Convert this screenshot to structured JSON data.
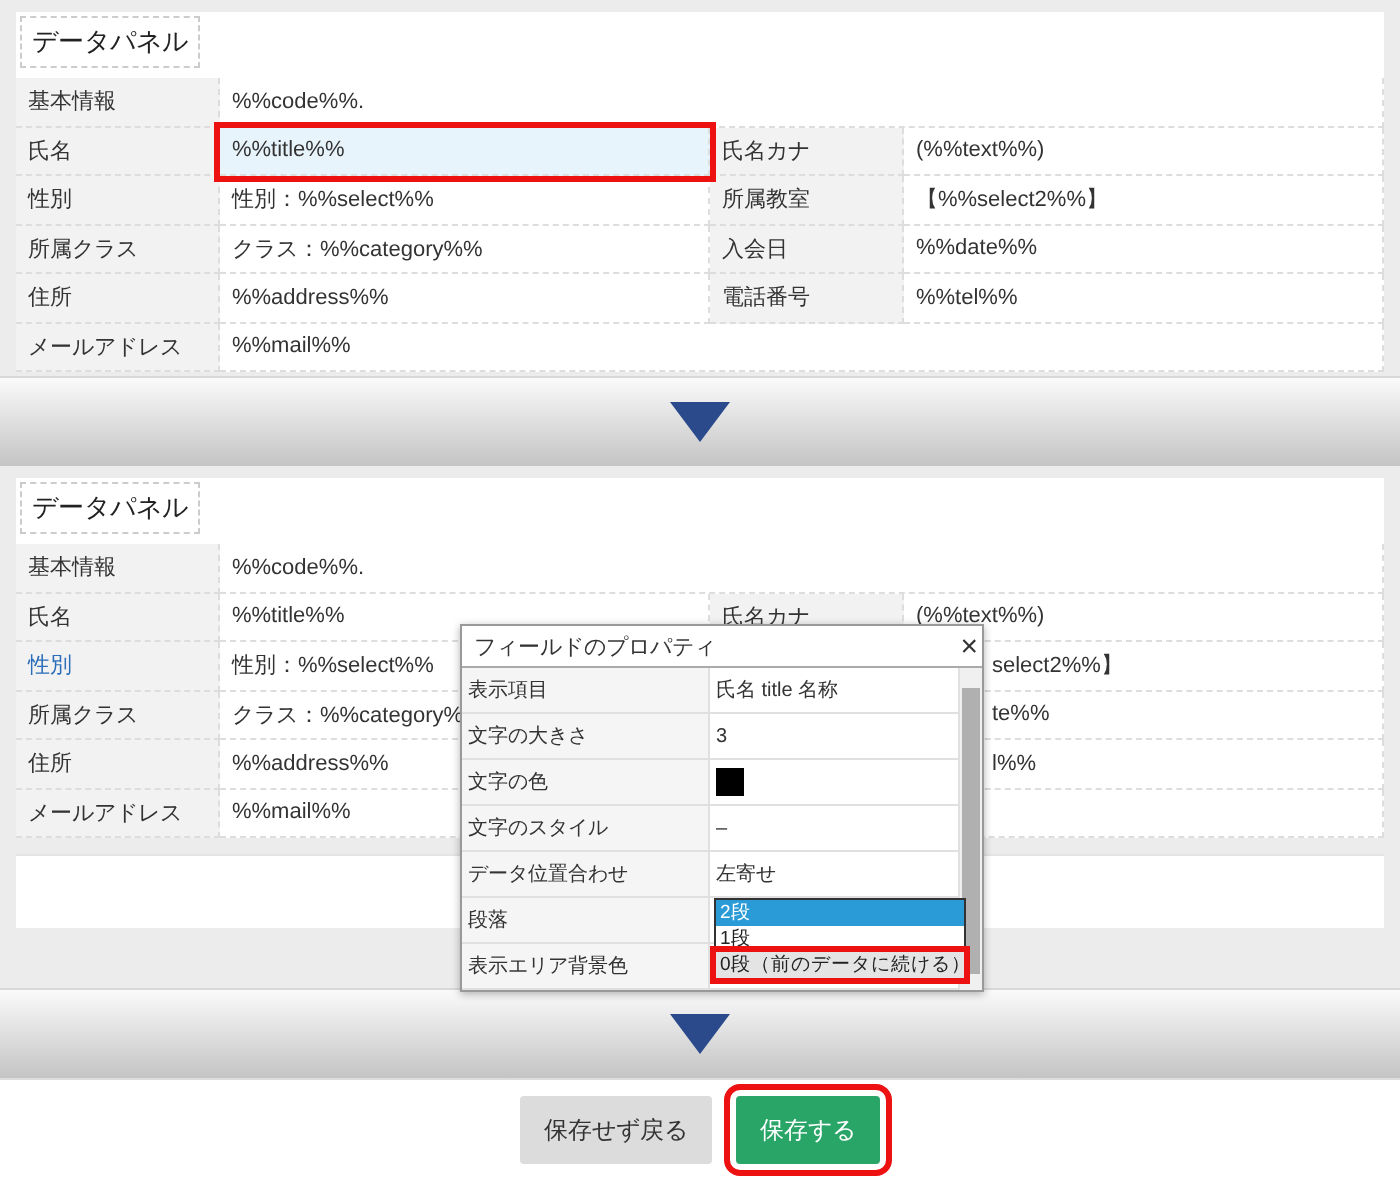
{
  "panels": [
    {
      "title": "データパネル",
      "blank_area": false,
      "rows": [
        {
          "cells": [
            {
              "kind": "label",
              "text": "基本情報"
            },
            {
              "kind": "value",
              "text": "%%code%%."
            }
          ]
        },
        {
          "cells": [
            {
              "kind": "label",
              "text": "氏名"
            },
            {
              "kind": "value",
              "text": "%%title%%",
              "highlighted": true
            },
            {
              "kind": "label",
              "text": "氏名カナ"
            },
            {
              "kind": "value",
              "text": "(%%text%%)"
            }
          ]
        },
        {
          "cells": [
            {
              "kind": "label",
              "text": "性別"
            },
            {
              "kind": "value",
              "text": "性別：%%select%%"
            },
            {
              "kind": "label",
              "text": "所属教室"
            },
            {
              "kind": "value",
              "text": "【%%select2%%】"
            }
          ]
        },
        {
          "cells": [
            {
              "kind": "label",
              "text": "所属クラス"
            },
            {
              "kind": "value",
              "text": "クラス：%%category%%"
            },
            {
              "kind": "label",
              "text": "入会日"
            },
            {
              "kind": "value",
              "text": "%%date%%"
            }
          ]
        },
        {
          "cells": [
            {
              "kind": "label",
              "text": "住所"
            },
            {
              "kind": "value",
              "text": "%%address%%"
            },
            {
              "kind": "label",
              "text": "電話番号"
            },
            {
              "kind": "value",
              "text": "%%tel%%"
            }
          ]
        },
        {
          "cells": [
            {
              "kind": "label",
              "text": "メールアドレス"
            },
            {
              "kind": "value",
              "text": "%%mail%%"
            }
          ]
        }
      ]
    },
    {
      "title": "データパネル",
      "blank_area": true,
      "rows": [
        {
          "cells": [
            {
              "kind": "label",
              "text": "基本情報"
            },
            {
              "kind": "value",
              "text": "%%code%%."
            }
          ]
        },
        {
          "cells": [
            {
              "kind": "label",
              "text": "氏名"
            },
            {
              "kind": "value",
              "text": "%%title%%"
            },
            {
              "kind": "label",
              "text": "氏名カナ"
            },
            {
              "kind": "value",
              "text": "(%%text%%)"
            }
          ]
        },
        {
          "cells": [
            {
              "kind": "label",
              "text": "性別",
              "active": true
            },
            {
              "kind": "value",
              "text": "性別：%%select%%"
            },
            {
              "kind": "value",
              "text": "select2%%】",
              "clipped": true
            }
          ]
        },
        {
          "cells": [
            {
              "kind": "label",
              "text": "所属クラス"
            },
            {
              "kind": "value",
              "text": "クラス：%%category%"
            },
            {
              "kind": "value",
              "text": "te%%",
              "clipped": true
            }
          ]
        },
        {
          "cells": [
            {
              "kind": "label",
              "text": "住所"
            },
            {
              "kind": "value",
              "text": "%%address%%"
            },
            {
              "kind": "value",
              "text": "l%%",
              "clipped": true
            }
          ]
        },
        {
          "cells": [
            {
              "kind": "label",
              "text": "メールアドレス"
            },
            {
              "kind": "value",
              "text": "%%mail%%"
            }
          ]
        }
      ],
      "popup": {
        "title": "フィールドのプロパティ",
        "close": "×",
        "rows": [
          {
            "kind": "text",
            "label": "表示項目",
            "value": "氏名 title 名称"
          },
          {
            "kind": "text",
            "label": "文字の大きさ",
            "value": "3"
          },
          {
            "kind": "swatch",
            "label": "文字の色",
            "color": "#000000"
          },
          {
            "kind": "text",
            "label": "文字のスタイル",
            "value": "–"
          },
          {
            "kind": "text",
            "label": "データ位置合わせ",
            "value": "左寄せ"
          },
          {
            "kind": "listbox",
            "label": "段落",
            "options": [
              {
                "text": "2段",
                "selected": true,
                "highlighted": false
              },
              {
                "text": "1段",
                "selected": false,
                "highlighted": false
              },
              {
                "text": "0段（前のデータに続ける）",
                "selected": false,
                "highlighted": true
              }
            ]
          },
          {
            "kind": "text",
            "label": "表示エリア背景色"
          }
        ]
      }
    }
  ],
  "buttons": [
    {
      "label": "保存せず戻る",
      "kind": "secondary",
      "highlighted": false
    },
    {
      "label": "保存する",
      "kind": "primary",
      "highlighted": true
    }
  ]
}
